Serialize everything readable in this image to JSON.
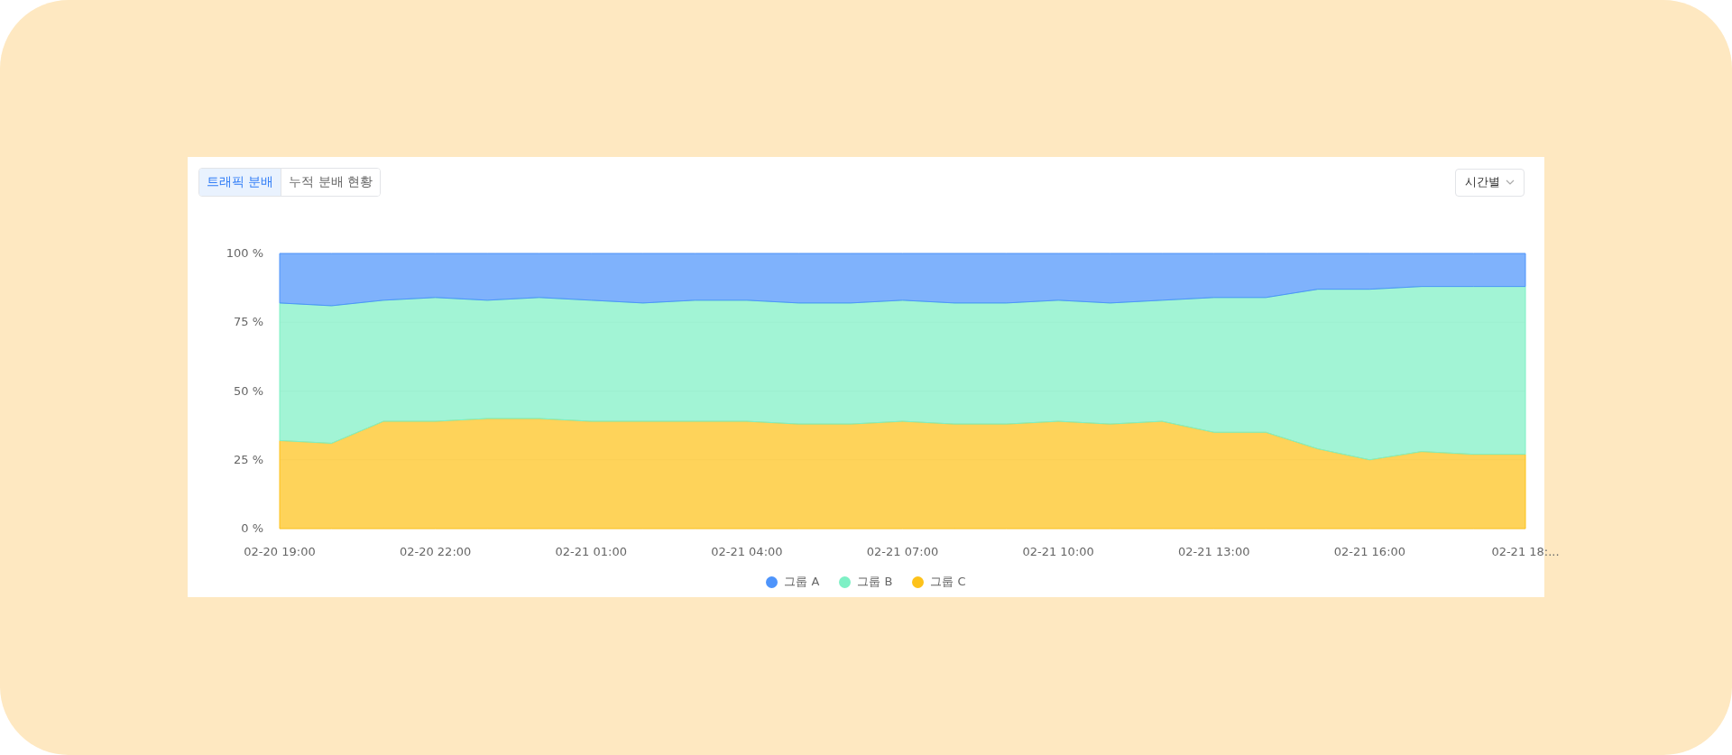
{
  "tabs": [
    {
      "label": "트래픽 분배",
      "selected": true
    },
    {
      "label": "누적 분배 현황",
      "selected": false
    }
  ],
  "period_select": {
    "value": "시간별"
  },
  "chart_data": {
    "type": "area",
    "stacked": true,
    "categories": [
      "02-20 19:00",
      null,
      null,
      "02-20 22:00",
      null,
      null,
      "02-21 01:00",
      null,
      null,
      "02-21 04:00",
      null,
      null,
      "02-21 07:00",
      null,
      null,
      "02-21 10:00",
      null,
      null,
      "02-21 13:00",
      null,
      null,
      "02-21 16:00",
      null,
      null,
      "02-21 18:..."
    ],
    "ylim": [
      0,
      100
    ],
    "yticks": [
      {
        "value": 0,
        "label": "0 %"
      },
      {
        "value": 25,
        "label": "25 %"
      },
      {
        "value": 50,
        "label": "50 %"
      },
      {
        "value": 75,
        "label": "75 %"
      },
      {
        "value": 100,
        "label": "100 %"
      }
    ],
    "series": [
      {
        "name": "그룹 A",
        "color": "#4e94fb",
        "values": [
          18,
          19,
          17,
          16,
          17,
          16,
          17,
          18,
          17,
          17,
          18,
          18,
          17,
          18,
          18,
          17,
          18,
          17,
          16,
          16,
          13,
          13,
          12,
          12,
          12
        ]
      },
      {
        "name": "그룹 B",
        "color": "#7ef0c5",
        "values": [
          50,
          50,
          44,
          45,
          43,
          44,
          44,
          43,
          44,
          44,
          44,
          44,
          44,
          44,
          44,
          44,
          44,
          44,
          49,
          49,
          58,
          62,
          60,
          61,
          61
        ]
      },
      {
        "name": "그룹 C",
        "color": "#fdc21a",
        "values": [
          32,
          31,
          39,
          39,
          40,
          40,
          39,
          39,
          39,
          39,
          38,
          38,
          39,
          38,
          38,
          39,
          38,
          39,
          35,
          35,
          29,
          25,
          28,
          27,
          27
        ]
      }
    ]
  }
}
